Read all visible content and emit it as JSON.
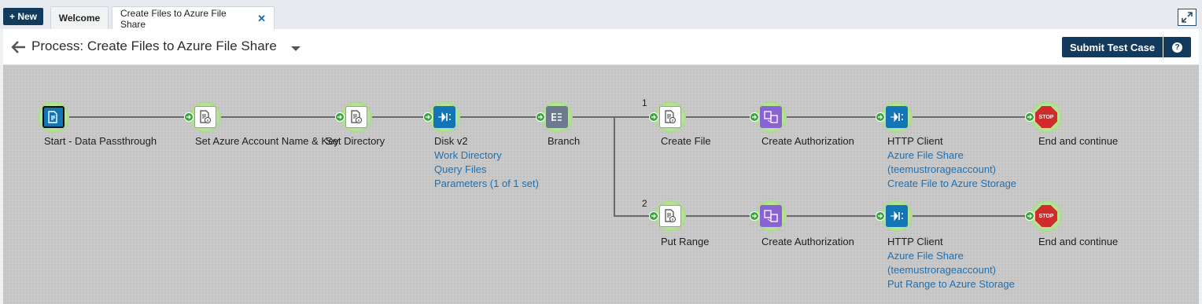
{
  "topbar": {
    "new_label": "+ New",
    "tabs": [
      {
        "label": "Welcome"
      },
      {
        "label": "Create Files to Azure File Share",
        "close": "✕"
      }
    ]
  },
  "header": {
    "title": "Process: Create Files to Azure File Share",
    "submit_label": "Submit Test Case",
    "help_label": "?"
  },
  "canvas": {
    "branch_numbers": [
      "1",
      "2"
    ],
    "shapes": {
      "start": {
        "label": "Start - Data Passthrough",
        "icon": "document-arrow-icon"
      },
      "set_props": {
        "label": "Set Azure Account Name & Key",
        "icon": "document-info-icon"
      },
      "set_dir": {
        "label": "Set Directory",
        "icon": "document-info-icon"
      },
      "disk": {
        "label": "Disk v2",
        "icon": "connector-icon",
        "links": [
          "Work Directory",
          "Query Files",
          "Parameters (1 of 1 set)"
        ]
      },
      "branch": {
        "label": "Branch",
        "icon": "branch-icon"
      },
      "create_file": {
        "label": "Create File",
        "icon": "document-info-icon"
      },
      "auth_1": {
        "label": "Create Authorization",
        "icon": "map-icon"
      },
      "http_1": {
        "label": "HTTP Client",
        "icon": "connector-icon",
        "links": [
          "Azure File Share",
          "(teemustrorageaccount)",
          "Create File to Azure Storage"
        ]
      },
      "stop_1": {
        "label": "End and continue",
        "icon": "stop-icon",
        "text": "STOP"
      },
      "put_range": {
        "label": "Put Range",
        "icon": "document-info-icon"
      },
      "auth_2": {
        "label": "Create Authorization",
        "icon": "map-icon"
      },
      "http_2": {
        "label": "HTTP Client",
        "icon": "connector-icon",
        "links": [
          "Azure File Share",
          "(teemustrorageaccount)",
          "Put Range to Azure Storage"
        ]
      },
      "stop_2": {
        "label": "End and continue",
        "icon": "stop-icon",
        "text": "STOP"
      }
    }
  },
  "colors": {
    "accent": "#113a5d",
    "connector_blue": "#1375b6",
    "link_blue": "#1a72b8",
    "map_purple": "#8a63d2",
    "stop_red": "#d22b2b",
    "shape_halo": "#a6d97e"
  }
}
